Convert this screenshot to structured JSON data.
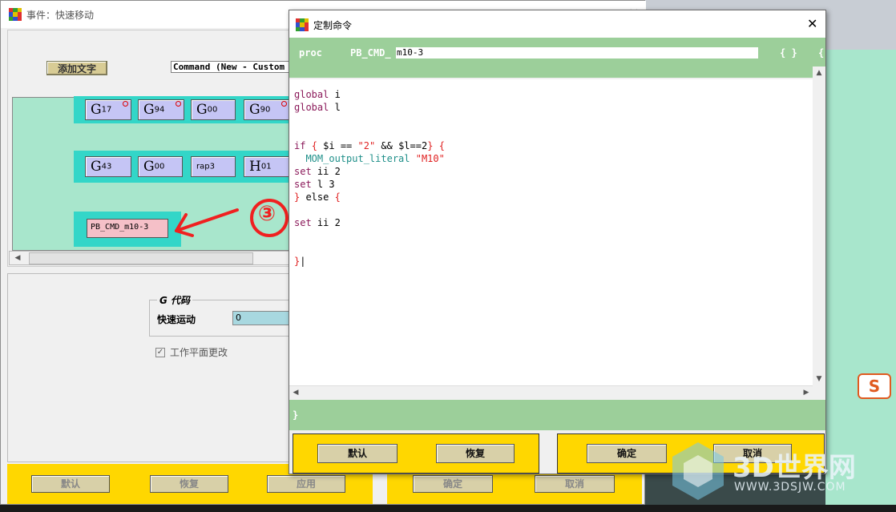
{
  "event_window": {
    "title": "事件：快速移动",
    "add_text_button": "添加文字",
    "command_bar": "Command (New - Custom",
    "row1": [
      {
        "letter": "G",
        "code": "17",
        "flag": true
      },
      {
        "letter": "G",
        "code": "94",
        "flag": true
      },
      {
        "letter": "G",
        "code": "00",
        "flag": false
      },
      {
        "letter": "G",
        "code": "90",
        "flag": true
      }
    ],
    "row2": [
      {
        "letter": "G",
        "code": "43"
      },
      {
        "letter": "G",
        "code": "00"
      },
      {
        "letter": "",
        "code": "rap3"
      },
      {
        "letter": "H",
        "code": "01"
      }
    ],
    "custom_block": "PB_CMD_m10-3",
    "annotation": "③",
    "group_title": "G 代码",
    "rapid_label": "快速运动",
    "rapid_value": "0",
    "wcs_checkbox_label": "工作平面更改",
    "buttons": {
      "default": "默认",
      "restore": "恢复",
      "apply": "应用",
      "ok": "确定",
      "cancel": "取消"
    }
  },
  "dialog": {
    "title": "定制命令",
    "proc_label": "proc",
    "proc_prefix": "PB_CMD_",
    "proc_name": "m10-3",
    "braces": "{ }",
    "brace_extra": "{",
    "footer_brace": "}",
    "buttons": {
      "default": "默认",
      "restore": "恢复",
      "ok": "确定",
      "cancel": "取消"
    }
  },
  "watermark": {
    "brand": "3D世界网",
    "url": "WWW.3DSJW.COM"
  },
  "tray_icon": "S"
}
